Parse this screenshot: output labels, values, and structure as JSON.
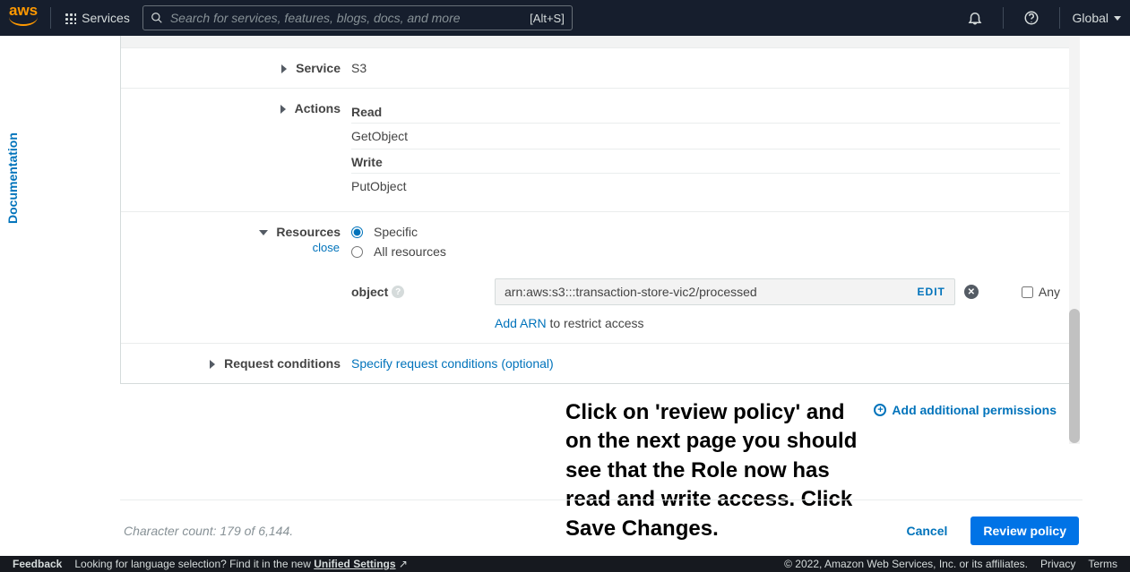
{
  "header": {
    "logo": "aws",
    "services": "Services",
    "search_placeholder": "Search for services, features, blogs, docs, and more",
    "shortcut": "[Alt+S]",
    "global": "Global"
  },
  "doc_tab": "Documentation",
  "policy": {
    "service": {
      "label": "Service",
      "value": "S3"
    },
    "actions": {
      "label": "Actions",
      "groups": [
        {
          "head": "Read",
          "items": [
            "GetObject"
          ]
        },
        {
          "head": "Write",
          "items": [
            "PutObject"
          ]
        }
      ]
    },
    "resources": {
      "label": "Resources",
      "close": "close",
      "radios": [
        "Specific",
        "All resources"
      ],
      "object_label": "object",
      "arn": "arn:aws:s3:::transaction-store-vic2/processed",
      "edit": "EDIT",
      "any": "Any",
      "add_arn": "Add ARN",
      "restrict": " to restrict access"
    },
    "conditions": {
      "label": "Request conditions",
      "specify": "Specify request conditions (optional)"
    }
  },
  "add_permissions": "Add additional permissions",
  "callout": "Click on 'review policy' and on the next page you should see that the Role now has read and write access. Click Save Changes.",
  "bottom": {
    "char_count": "Character count: 179 of 6,144.",
    "cancel": "Cancel",
    "review": "Review policy"
  },
  "footer": {
    "feedback": "Feedback",
    "lang": "Looking for language selection? Find it in the new ",
    "unified": "Unified Settings",
    "copyright": "© 2022, Amazon Web Services, Inc. or its affiliates.",
    "privacy": "Privacy",
    "terms": "Terms"
  }
}
